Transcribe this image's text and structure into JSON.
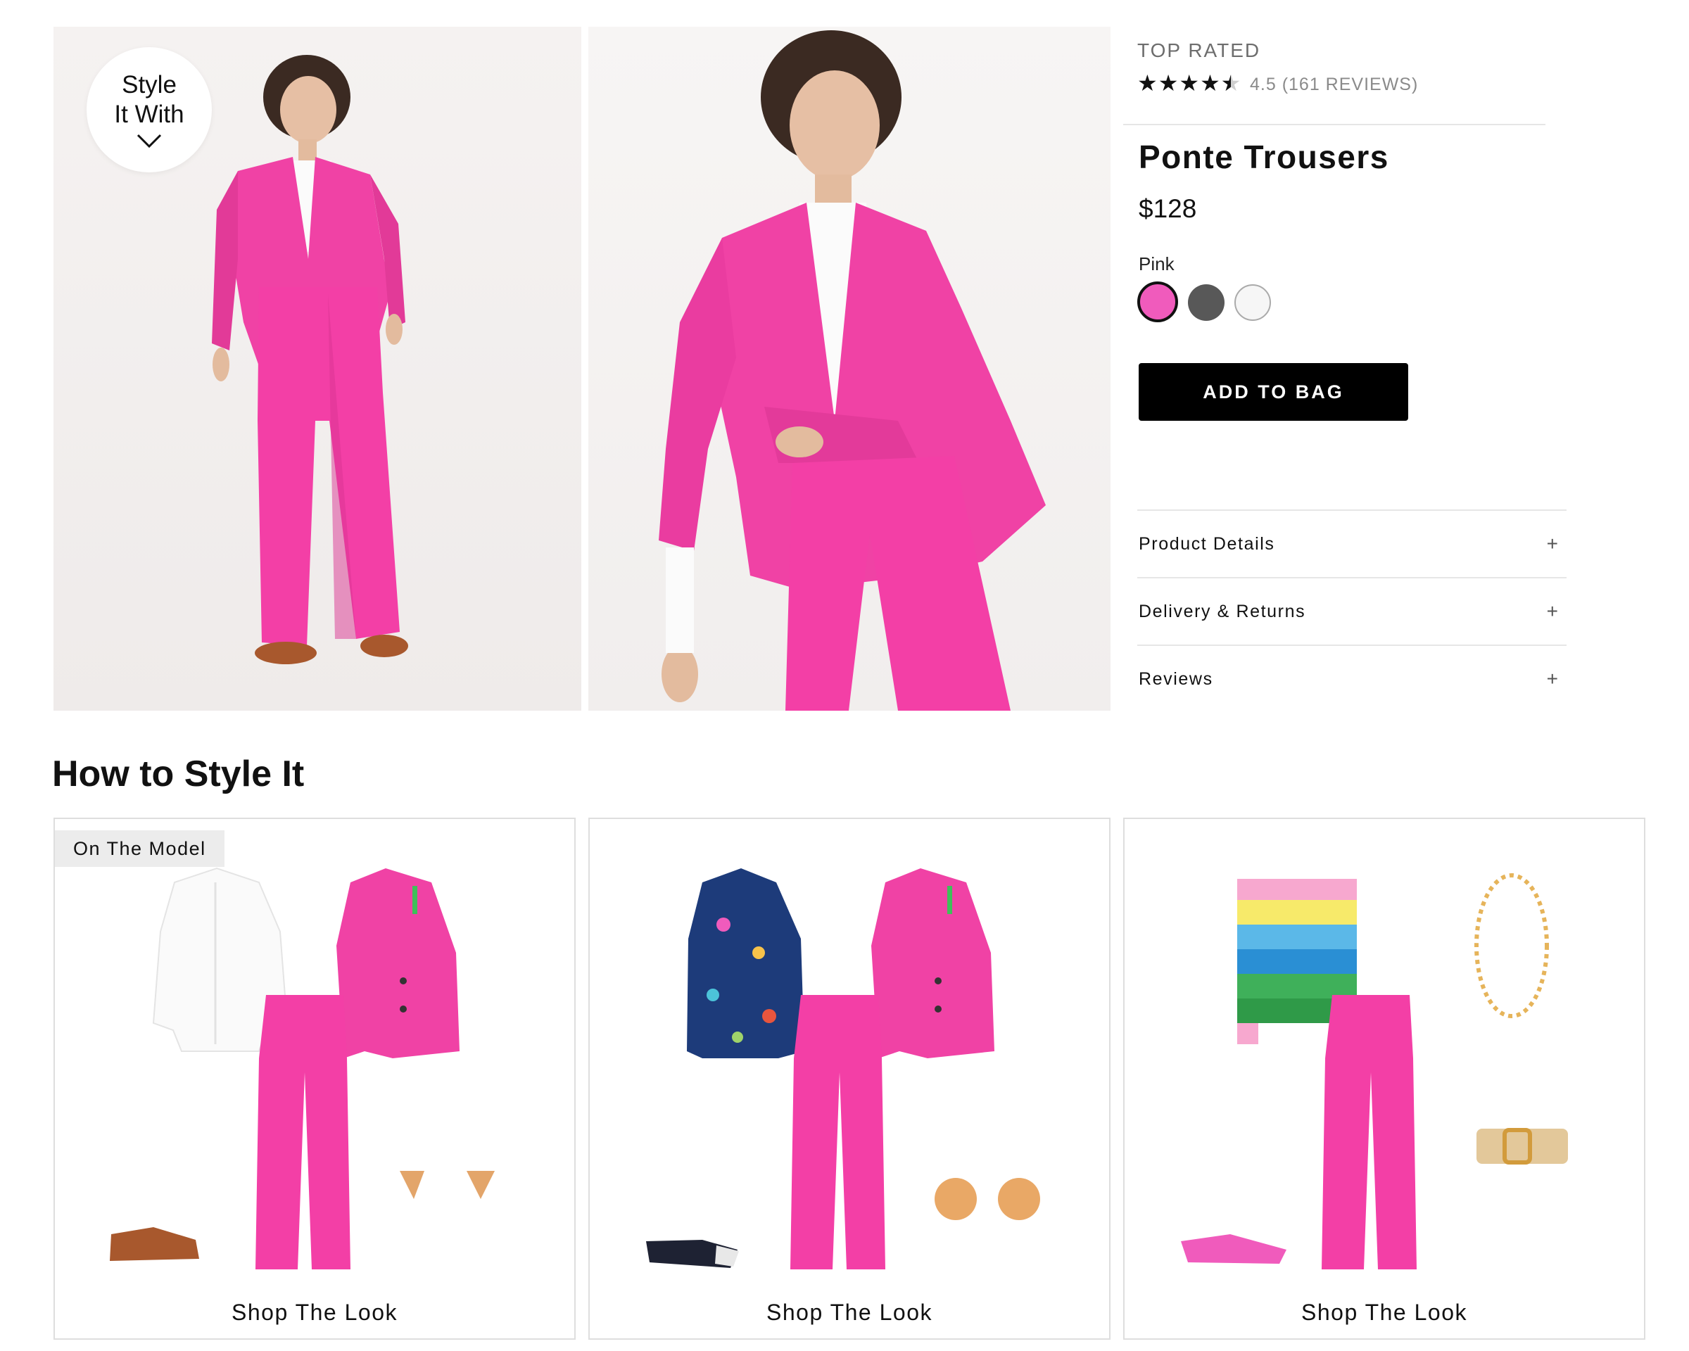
{
  "gallery": {
    "style_badge": {
      "line1": "Style",
      "line2": "It With"
    }
  },
  "product": {
    "badge": "TOP RATED",
    "rating_value": 4.5,
    "rating_max": 5,
    "rating_text": "4.5 (161 REVIEWS)",
    "title": "Ponte Trousers",
    "price": "$128",
    "color_label": "Pink",
    "swatches": [
      {
        "name": "pink",
        "color": "#f05bbc",
        "selected": true
      },
      {
        "name": "charcoal",
        "color": "#585858",
        "selected": false
      },
      {
        "name": "white",
        "color": "#f6f6f6",
        "selected": false
      }
    ],
    "add_to_bag": "ADD TO BAG",
    "accordion": [
      "Product Details",
      "Delivery & Returns",
      "Reviews"
    ]
  },
  "style_section": {
    "title": "How to Style It",
    "cards": [
      {
        "tag": "On The Model",
        "cta": "Shop The Look"
      },
      {
        "tag": "",
        "cta": "Shop The Look"
      },
      {
        "tag": "",
        "cta": "Shop The Look"
      }
    ]
  },
  "colors": {
    "brand_pink": "#f0429f",
    "button_black": "#000000",
    "muted_text": "#6d6d6d"
  }
}
